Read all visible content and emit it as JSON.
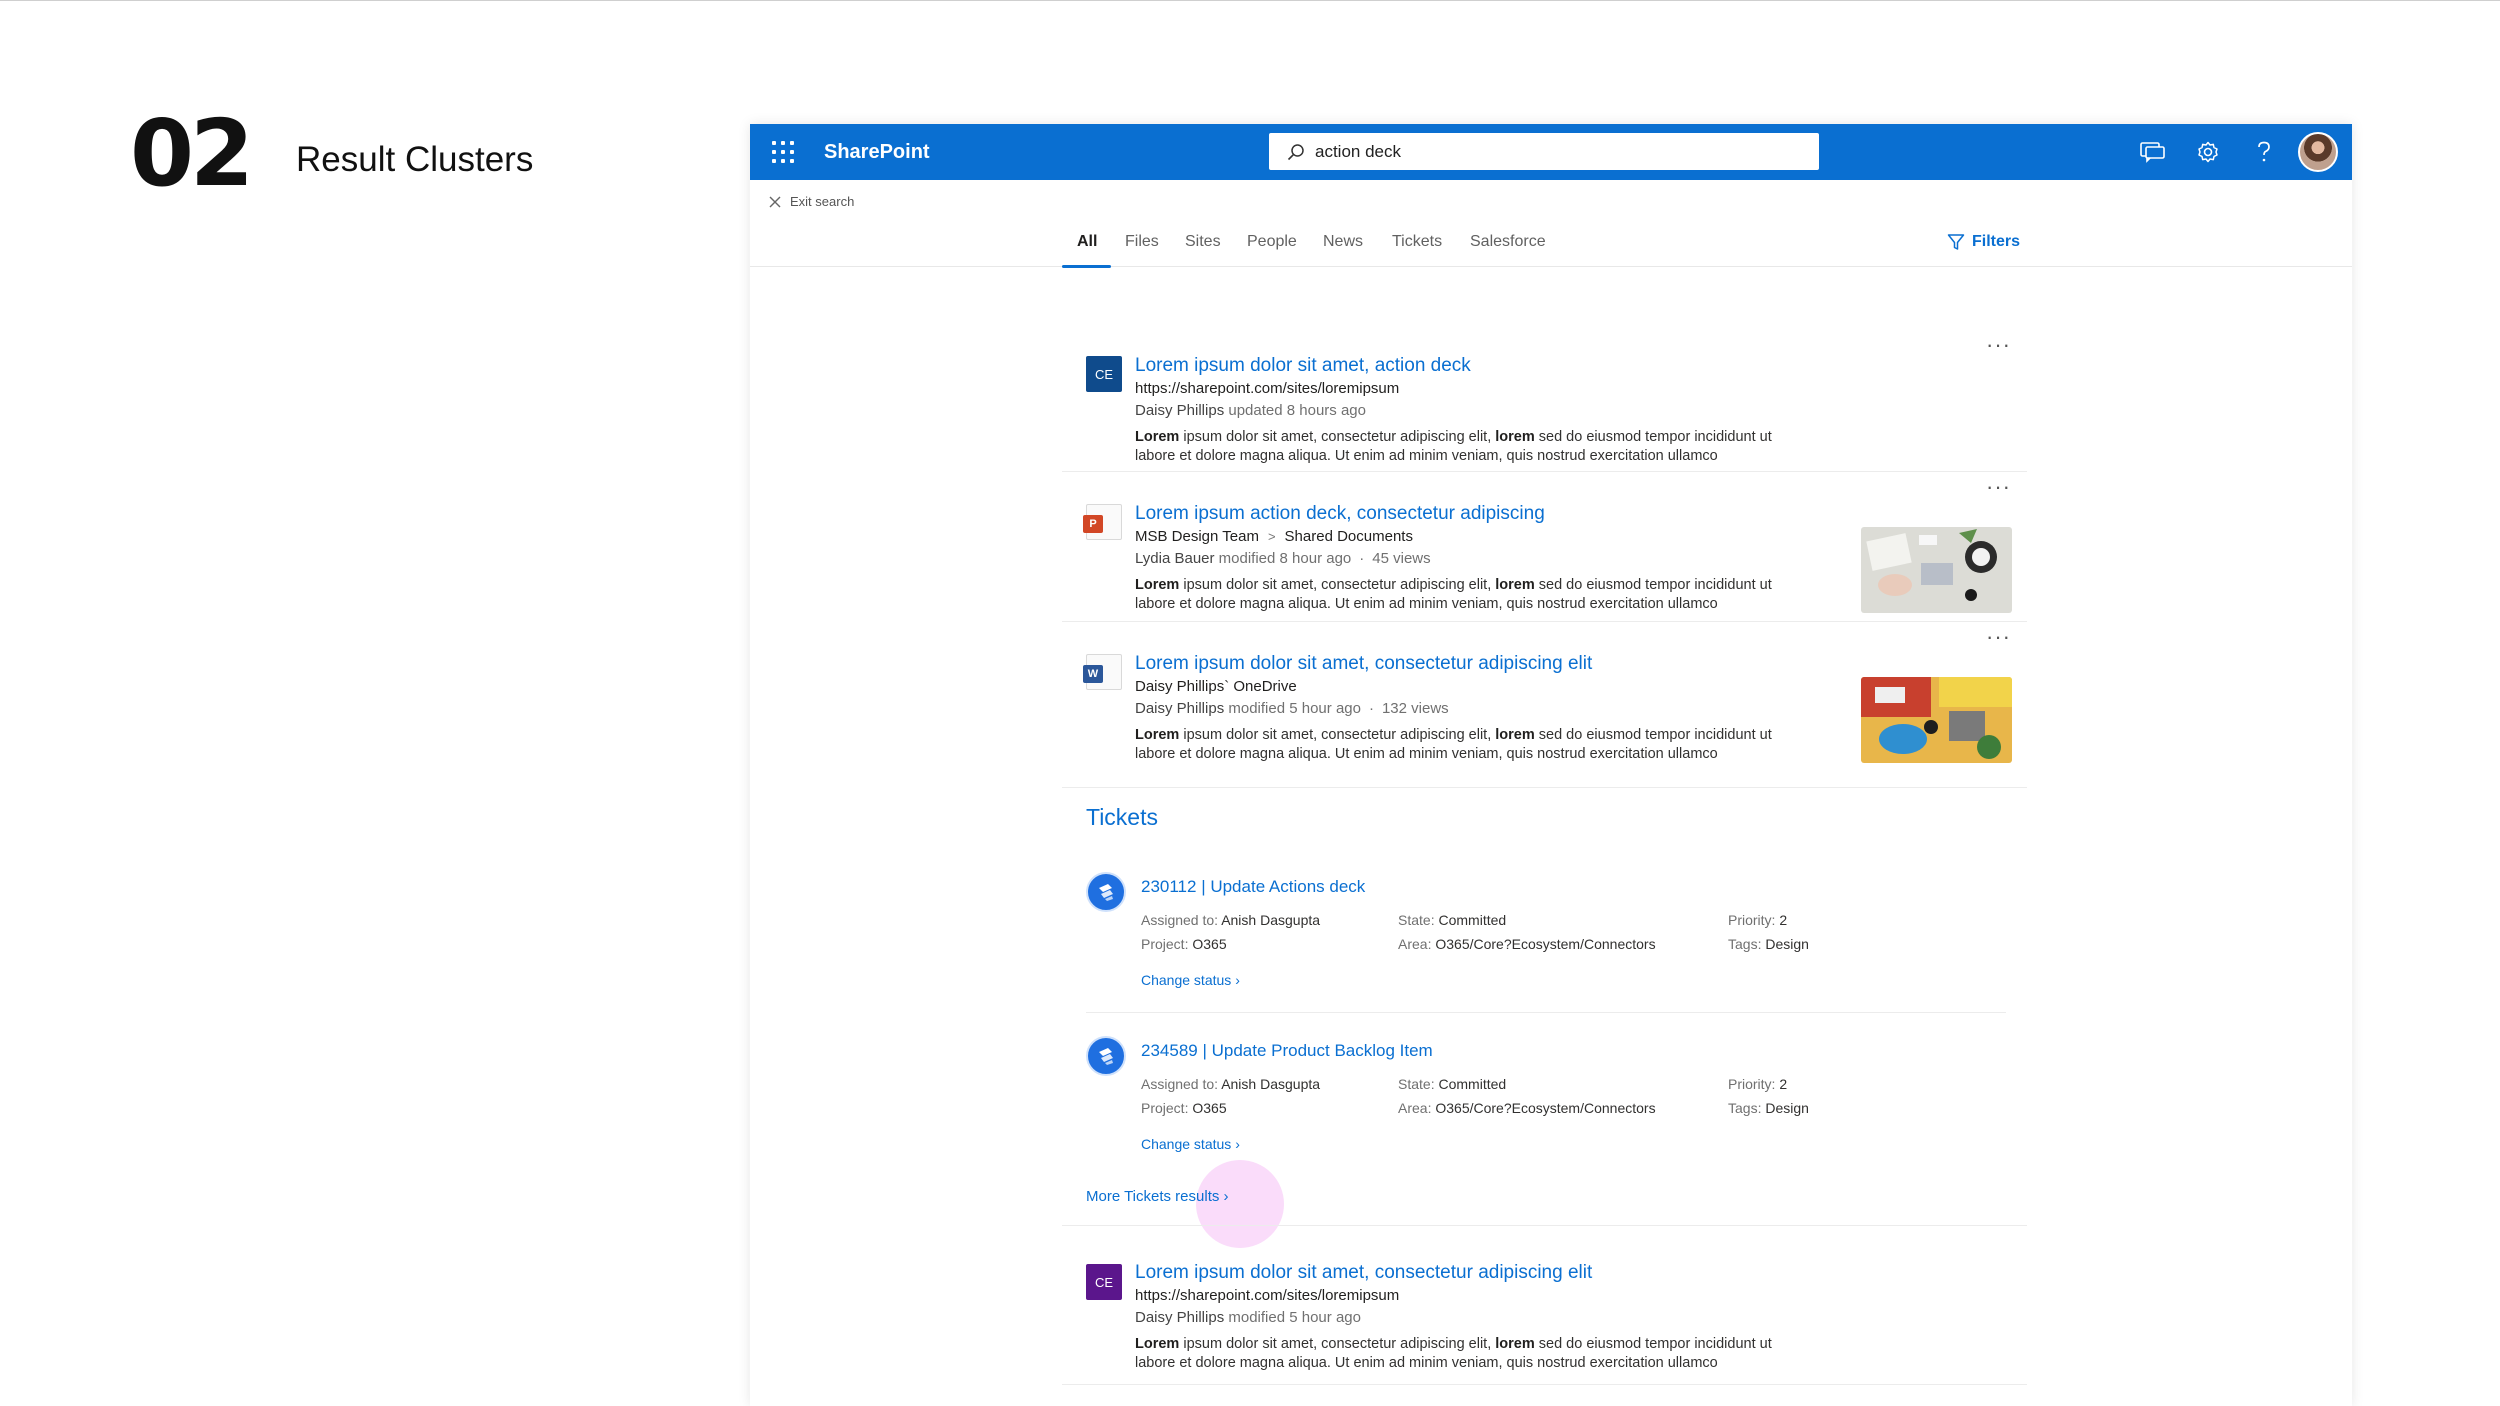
{
  "slide": {
    "number": "02",
    "title": "Result Clusters"
  },
  "suitebar": {
    "brand": "SharePoint",
    "search_value": "action deck",
    "icons": [
      "feedback-icon",
      "gear-icon",
      "help-icon",
      "avatar"
    ]
  },
  "exit_search": "Exit search",
  "tabs": [
    "All",
    "Files",
    "Sites",
    "People",
    "News",
    "Tickets",
    "Salesforce"
  ],
  "active_tab": "All",
  "filters_label": "Filters",
  "results": [
    {
      "icon": "CE",
      "title": "Lorem ipsum dolor sit amet, action deck",
      "url": "https://sharepoint.com/sites/loremipsum",
      "meta_person": "Daisy Phillips",
      "meta_text": "updated 8 hours ago",
      "snippet_a": "Lorem",
      "snippet_b": " ipsum dolor sit amet, consectetur adipiscing elit, ",
      "snippet_c": "lorem",
      "snippet_d": " sed do eiusmod tempor incididunt ut labore et dolore magna aliqua. Ut enim ad minim veniam, quis nostrud exercitation ullamco"
    },
    {
      "icon": "P",
      "title": "Lorem ipsum action deck, consectetur adipiscing",
      "path_a": "MSB Design Team",
      "path_sep": ">",
      "path_b": "Shared Documents",
      "meta_person": "Lydia Bauer",
      "meta_text": "modified 8 hour ago",
      "meta_views": "45 views",
      "snippet_a": "Lorem",
      "snippet_b": " ipsum dolor sit amet, consectetur adipiscing elit, ",
      "snippet_c": "lorem",
      "snippet_d": " sed do eiusmod tempor incididunt ut labore et dolore magna aliqua. Ut enim ad minim veniam, quis nostrud exercitation ullamco"
    },
    {
      "icon": "W",
      "title": "Lorem ipsum dolor sit amet, consectetur adipiscing elit",
      "path_a": "Daisy Phillips` OneDrive",
      "meta_person": "Daisy Phillips",
      "meta_text": "modified 5 hour ago",
      "meta_views": "132 views",
      "snippet_a": "Lorem",
      "snippet_b": " ipsum dolor sit amet, consectetur adipiscing elit, ",
      "snippet_c": "lorem",
      "snippet_d": " sed do eiusmod tempor incididunt ut labore et dolore magna aliqua. Ut enim ad minim veniam, quis nostrud exercitation ullamco"
    },
    {
      "icon": "CE",
      "title": "Lorem ipsum dolor sit amet, consectetur adipiscing elit",
      "url": "https://sharepoint.com/sites/loremipsum",
      "meta_person": "Daisy Phillips",
      "meta_text": "modified 5 hour ago",
      "snippet_a": "Lorem",
      "snippet_b": " ipsum dolor sit amet, consectetur adipiscing elit, ",
      "snippet_c": "lorem",
      "snippet_d": " sed do eiusmod tempor incididunt ut labore et dolore magna aliqua. Ut enim ad minim veniam, quis nostrud exercitation ullamco"
    }
  ],
  "tickets_section": {
    "heading": "Tickets",
    "items": [
      {
        "title": "230112 | Update Actions deck",
        "assigned_label": "Assigned to:",
        "assigned": "Anish Dasgupta",
        "project_label": "Project:",
        "project": "O365",
        "state_label": "State:",
        "state": "Committed",
        "area_label": "Area:",
        "area": "O365/Core?Ecosystem/Connectors",
        "priority_label": "Priority:",
        "priority": "2",
        "tags_label": "Tags:",
        "tags": "Design",
        "action": "Change status"
      },
      {
        "title": "234589 | Update Product Backlog Item",
        "assigned_label": "Assigned to:",
        "assigned": "Anish Dasgupta",
        "project_label": "Project:",
        "project": "O365",
        "state_label": "State:",
        "state": "Committed",
        "area_label": "Area:",
        "area": "O365/Core?Ecosystem/Connectors",
        "priority_label": "Priority:",
        "priority": "2",
        "tags_label": "Tags:",
        "tags": "Design",
        "action": "Change status"
      }
    ],
    "more": "More Tickets results"
  },
  "colors": {
    "accent": "#0a6fd1",
    "ce_blue": "#0f4b8c",
    "ce_purple": "#5b168c",
    "powerpoint": "#d24726",
    "word": "#2b579a"
  }
}
